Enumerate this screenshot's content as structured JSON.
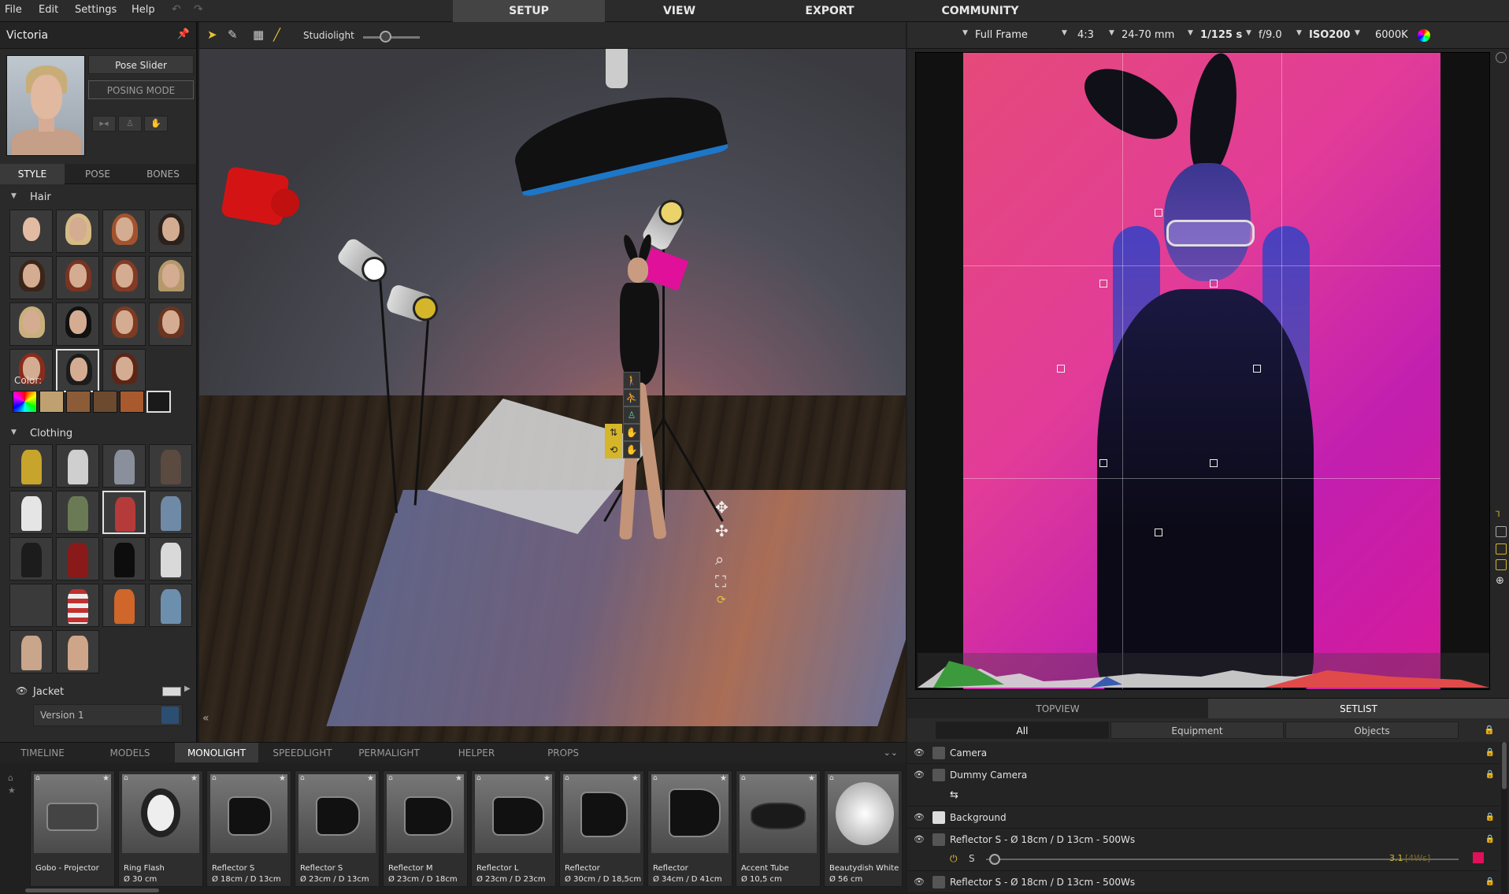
{
  "menu": {
    "items": [
      "File",
      "Edit",
      "Settings",
      "Help"
    ]
  },
  "top_tabs": [
    "SETUP",
    "VIEW",
    "EXPORT",
    "COMMUNITY"
  ],
  "active_top_tab": "SETUP",
  "character": {
    "name": "Victoria",
    "pose_slider_label": "Pose Slider",
    "posing_mode_label": "POSING MODE"
  },
  "style_tabs": [
    "STYLE",
    "POSE",
    "BONES"
  ],
  "hair_section": {
    "title": "Hair",
    "color_label": "Color:"
  },
  "clothing_section": {
    "title": "Clothing"
  },
  "clothing_item": {
    "label": "Jacket",
    "version": "Version 1"
  },
  "viewport": {
    "studiolight_label": "Studiolight",
    "studiolight_level": 0.4
  },
  "camera_settings": {
    "format": "Full Frame",
    "aspect": "4:3",
    "lens": "24-70 mm",
    "shutter": "1/125 s",
    "aperture": "f/9.0",
    "iso": "ISO200",
    "white_balance": "6000K"
  },
  "view_tabs": [
    "TOPVIEW",
    "SETLIST"
  ],
  "setlist_filters": [
    "All",
    "Equipment",
    "Objects"
  ],
  "setlist": [
    {
      "label": "Camera",
      "icon": "camera-icon"
    },
    {
      "label": "Dummy Camera",
      "icon": "camera-icon"
    },
    {
      "label": "Background",
      "icon": "background-icon"
    },
    {
      "label": "Reflector S - Ø 18cm / D 13cm - 500Ws",
      "icon": "light-icon"
    },
    {
      "label": "Reflector S - Ø 18cm / D 13cm - 500Ws",
      "icon": "light-icon"
    }
  ],
  "reflector_control": {
    "mode": "S",
    "power_value": "3.1",
    "power_unit": "[4Ws]",
    "color": "#e0105a"
  },
  "library_tabs": [
    "TIMELINE",
    "MODELS",
    "MONOLIGHT",
    "SPEEDLIGHT",
    "PERMALIGHT",
    "HELPER",
    "PROPS"
  ],
  "active_library_tab": "MONOLIGHT",
  "library_items": [
    {
      "name": "Gobo - Projector",
      "dims": ""
    },
    {
      "name": "Ring Flash",
      "dims": "Ø 30 cm"
    },
    {
      "name": "Reflector S",
      "dims": "Ø 18cm / D 13cm"
    },
    {
      "name": "Reflector S",
      "dims": "Ø 23cm / D 13cm"
    },
    {
      "name": "Reflector M",
      "dims": "Ø 23cm / D 18cm"
    },
    {
      "name": "Reflector L",
      "dims": "Ø 23cm / D 23cm"
    },
    {
      "name": "Reflector",
      "dims": "Ø 30cm / D 18,5cm"
    },
    {
      "name": "Reflector",
      "dims": "Ø 34cm / D 41cm"
    },
    {
      "name": "Accent Tube",
      "dims": "Ø 10,5 cm"
    },
    {
      "name": "Beautydish White",
      "dims": "Ø 56 cm"
    }
  ],
  "colors": {
    "accent_blue": "#1d77c8",
    "magenta_backdrop": "#e23c98",
    "gizmo_yellow": "#d5b52a",
    "panel_dark": "#2a2a2a"
  }
}
